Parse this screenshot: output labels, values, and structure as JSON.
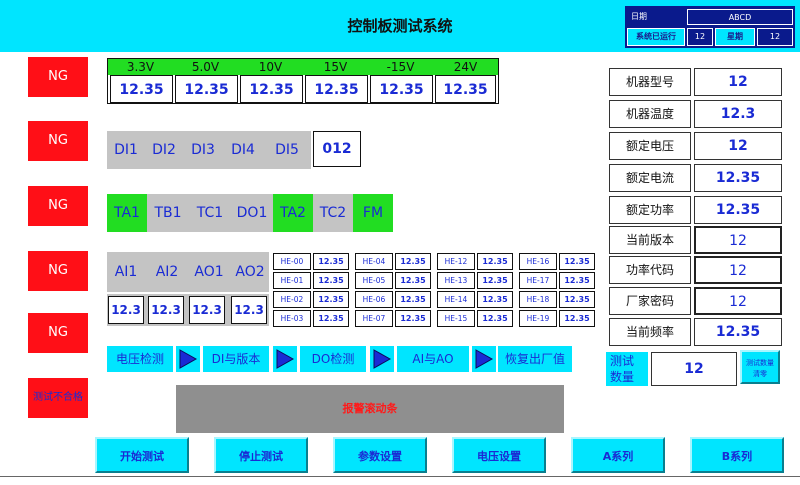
{
  "title": "控制板测试系统",
  "info": {
    "date_label": "日期",
    "date_value": "ABCD",
    "run_label": "系统已运行",
    "run_value": "12",
    "week_label": "星期",
    "week_value": "12"
  },
  "ng_labels": [
    "NG",
    "NG",
    "NG",
    "NG",
    "NG"
  ],
  "fail_label": "测试不合格",
  "voltages": {
    "headers": [
      "3.3V",
      "5.0V",
      "10V",
      "15V",
      "-15V",
      "24V"
    ],
    "values": [
      "12.35",
      "12.35",
      "12.35",
      "12.35",
      "12.35",
      "12.35"
    ]
  },
  "di": {
    "labels": [
      "DI1",
      "DI2",
      "DI3",
      "DI4",
      "DI5"
    ],
    "value": "012"
  },
  "io": {
    "labels": [
      "TA1",
      "TB1",
      "TC1",
      "DO1",
      "TA2",
      "TC2",
      "FM"
    ]
  },
  "ai": {
    "labels": [
      "AI1",
      "AI2",
      "AO1",
      "AO2"
    ],
    "values": [
      "12.3",
      "12.3",
      "12.3",
      "12.3"
    ]
  },
  "he": [
    [
      {
        "l": "HE-00",
        "v": "12.35"
      },
      {
        "l": "HE-04",
        "v": "12.35"
      },
      {
        "l": "HE-12",
        "v": "12.35"
      },
      {
        "l": "HE-16",
        "v": "12.35"
      }
    ],
    [
      {
        "l": "HE-01",
        "v": "12.35"
      },
      {
        "l": "HE-05",
        "v": "12.35"
      },
      {
        "l": "HE-13",
        "v": "12.35"
      },
      {
        "l": "HE-17",
        "v": "12.35"
      }
    ],
    [
      {
        "l": "HE-02",
        "v": "12.35"
      },
      {
        "l": "HE-06",
        "v": "12.35"
      },
      {
        "l": "HE-14",
        "v": "12.35"
      },
      {
        "l": "HE-18",
        "v": "12.35"
      }
    ],
    [
      {
        "l": "HE-03",
        "v": "12.35"
      },
      {
        "l": "HE-07",
        "v": "12.35"
      },
      {
        "l": "HE-15",
        "v": "12.35"
      },
      {
        "l": "HE-19",
        "v": "12.35"
      }
    ]
  ],
  "process": [
    "电压检测",
    "DI与版本",
    "DO检测",
    "AI与AO",
    "恢复出厂值"
  ],
  "right": [
    {
      "label": "机器型号",
      "value": "12"
    },
    {
      "label": "机器温度",
      "value": "12.3"
    },
    {
      "label": "额定电压",
      "value": "12"
    },
    {
      "label": "额定电流",
      "value": "12.35"
    },
    {
      "label": "额定功率",
      "value": "12.35"
    },
    {
      "label": "当前版本",
      "value": "12"
    },
    {
      "label": "功率代码",
      "value": "12"
    },
    {
      "label": "厂家密码",
      "value": "12"
    },
    {
      "label": "当前频率",
      "value": "12.35"
    }
  ],
  "count": {
    "label": "测试数量",
    "value": "12",
    "clear_label": "测试数量清零"
  },
  "alarm": "报警滚动条",
  "buttons": [
    "开始测试",
    "停止测试",
    "参数设置",
    "电压设置",
    "A系列",
    "B系列"
  ]
}
